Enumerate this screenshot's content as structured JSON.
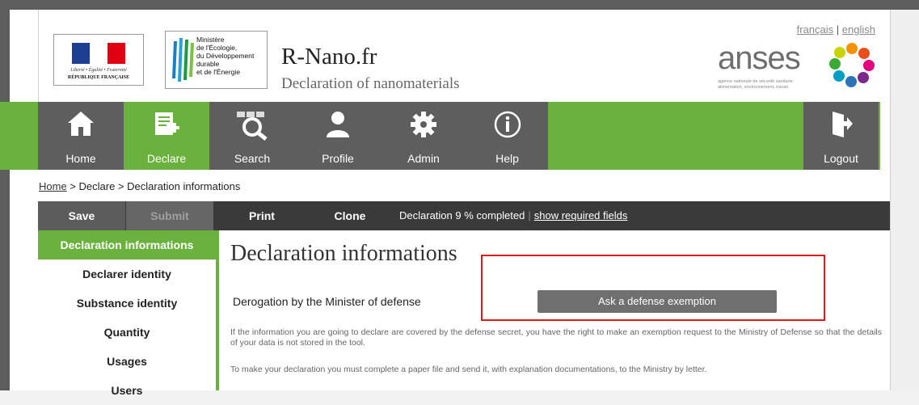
{
  "header": {
    "republic_motto": "Liberté • Égalité • Fraternité",
    "republic_name": "RÉPUBLIQUE FRANÇAISE",
    "ministry_text": [
      "Ministère",
      "de l'Écologie,",
      "du Développement",
      "durable",
      "et de l'Énergie"
    ],
    "site_title": "R-Nano.fr",
    "site_subtitle": "Declaration of nanomaterials",
    "lang_fr": "français",
    "lang_sep": "|",
    "lang_en": "english",
    "anses_word": "anses",
    "anses_small1": "agence nationale de sécurité sanitaire",
    "anses_small2": "alimentation, environnement, travail"
  },
  "nav": {
    "home": "Home",
    "declare": "Declare",
    "search": "Search",
    "profile": "Profile",
    "admin": "Admin",
    "help": "Help",
    "logout": "Logout"
  },
  "breadcrumb": {
    "home": "Home",
    "sep1": " > ",
    "declare": "Declare",
    "sep2": " > ",
    "current": "Declaration informations"
  },
  "toolbar": {
    "save": "Save",
    "submit": "Submit",
    "print": "Print",
    "clone": "Clone",
    "status": "Declaration 9 % completed",
    "sep": "|",
    "required_link": "show required fields"
  },
  "sidebar": {
    "items": [
      {
        "label": "Declaration informations"
      },
      {
        "label": "Declarer identity"
      },
      {
        "label": "Substance identity"
      },
      {
        "label": "Quantity"
      },
      {
        "label": "Usages"
      },
      {
        "label": "Users"
      }
    ]
  },
  "main": {
    "title": "Declaration informations",
    "derogation_label": "Derogation by the Minister of defense",
    "defense_button": "Ask a defense exemption",
    "info1": "If the information you are going to declare are covered by the defense secret, you have the right to make an exemption request to the Ministry of Defense so that the details of your data is not stored in the tool.",
    "info2": "To make your declaration you must complete a paper file and send it, with explanation documentations, to the Ministry by letter."
  },
  "colors": {
    "green": "#6ab23d",
    "dark_gray": "#5e5e5e",
    "toolbar": "#3a3a3a",
    "highlight_red": "#e0191b"
  }
}
